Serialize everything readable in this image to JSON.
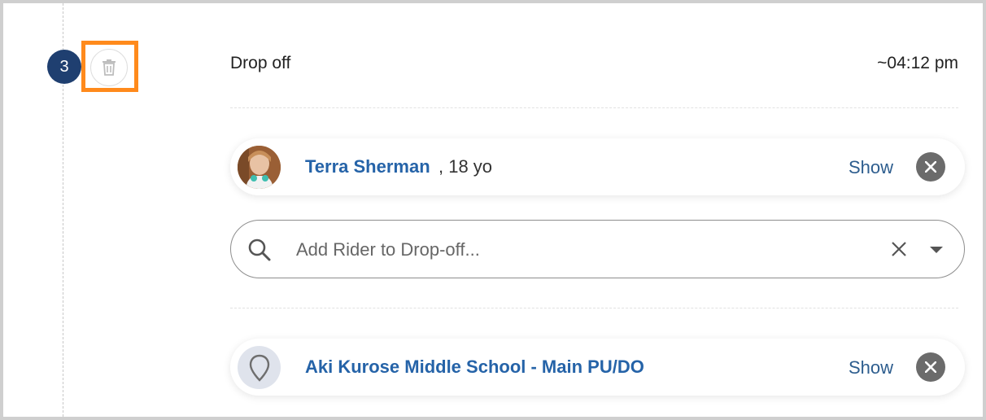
{
  "stop": {
    "number": "3",
    "title": "Drop off",
    "time": "~04:12 pm"
  },
  "rider": {
    "name": "Terra Sherman",
    "age": ", 18 yo",
    "show_label": "Show"
  },
  "search": {
    "placeholder": "Add Rider to Drop-off..."
  },
  "location": {
    "name": "Aki Kurose Middle School - Main PU/DO",
    "show_label": "Show"
  },
  "icons": {
    "trash": "trash-icon",
    "search": "search-icon",
    "clear": "close-icon",
    "dropdown": "caret-down-icon",
    "remove": "close-circle-icon",
    "location": "map-pin-icon"
  },
  "colors": {
    "badge": "#1f3f70",
    "highlight": "#ff8a1c",
    "link": "#2563a8",
    "remove_button": "#6b6b6b"
  }
}
